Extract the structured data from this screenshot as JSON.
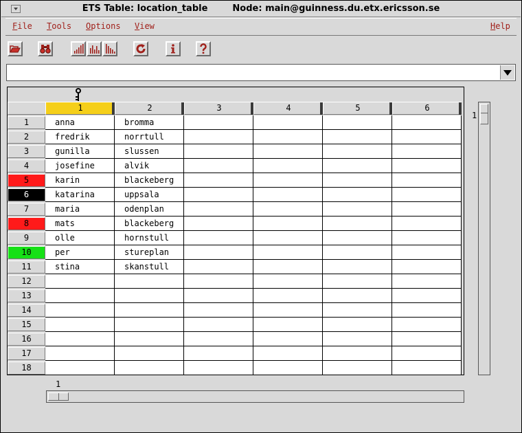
{
  "window": {
    "title_table": "ETS Table: location_table",
    "title_node": "Node: main@guinness.du.etx.ericsson.se"
  },
  "menubar": {
    "items": [
      {
        "first": "F",
        "rest": "ile"
      },
      {
        "first": "T",
        "rest": "ools"
      },
      {
        "first": "O",
        "rest": "ptions"
      },
      {
        "first": "V",
        "rest": "iew"
      }
    ],
    "help": {
      "first": "H",
      "rest": "elp"
    }
  },
  "toolbar": {
    "icons": [
      "open-file-icon",
      "binoculars-icon",
      "bar-chart-icon",
      "bar-chart-icon",
      "bar-chart-icon",
      "refresh-icon",
      "info-icon",
      "help-icon"
    ]
  },
  "search": {
    "value": ""
  },
  "table": {
    "key_column": 1,
    "selected_column": 1,
    "columns": [
      "1",
      "2",
      "3",
      "4",
      "5",
      "6"
    ],
    "rows": [
      {
        "num": "1",
        "cells": [
          "anna",
          "bromma"
        ],
        "marker": null
      },
      {
        "num": "2",
        "cells": [
          "fredrik",
          "norrtull"
        ],
        "marker": null
      },
      {
        "num": "3",
        "cells": [
          "gunilla",
          "slussen"
        ],
        "marker": null
      },
      {
        "num": "4",
        "cells": [
          "josefine",
          "alvik"
        ],
        "marker": null
      },
      {
        "num": "5",
        "cells": [
          "karin",
          "blackeberg"
        ],
        "marker": "#ff1a1a"
      },
      {
        "num": "6",
        "cells": [
          "katarina",
          "uppsala"
        ],
        "marker": "#000000"
      },
      {
        "num": "7",
        "cells": [
          "maria",
          "odenplan"
        ],
        "marker": null
      },
      {
        "num": "8",
        "cells": [
          "mats",
          "blackeberg"
        ],
        "marker": "#ff1a1a"
      },
      {
        "num": "9",
        "cells": [
          "olle",
          "hornstull"
        ],
        "marker": null
      },
      {
        "num": "10",
        "cells": [
          "per",
          "stureplan"
        ],
        "marker": "#16e016"
      },
      {
        "num": "11",
        "cells": [
          "stina",
          "skanstull"
        ],
        "marker": null
      },
      {
        "num": "12",
        "cells": [
          "",
          ""
        ],
        "marker": null
      },
      {
        "num": "13",
        "cells": [
          "",
          ""
        ],
        "marker": null
      },
      {
        "num": "14",
        "cells": [
          "",
          ""
        ],
        "marker": null
      },
      {
        "num": "15",
        "cells": [
          "",
          ""
        ],
        "marker": null
      },
      {
        "num": "16",
        "cells": [
          "",
          ""
        ],
        "marker": null
      },
      {
        "num": "17",
        "cells": [
          "",
          ""
        ],
        "marker": null
      },
      {
        "num": "18",
        "cells": [
          "",
          ""
        ],
        "marker": null
      }
    ]
  },
  "scroll": {
    "vertical_position": "1",
    "horizontal_position": "1"
  },
  "colors": {
    "menu_text": "#a0201a",
    "selected_column": "#f5cf1a",
    "window_bg": "#d9d9d9"
  }
}
